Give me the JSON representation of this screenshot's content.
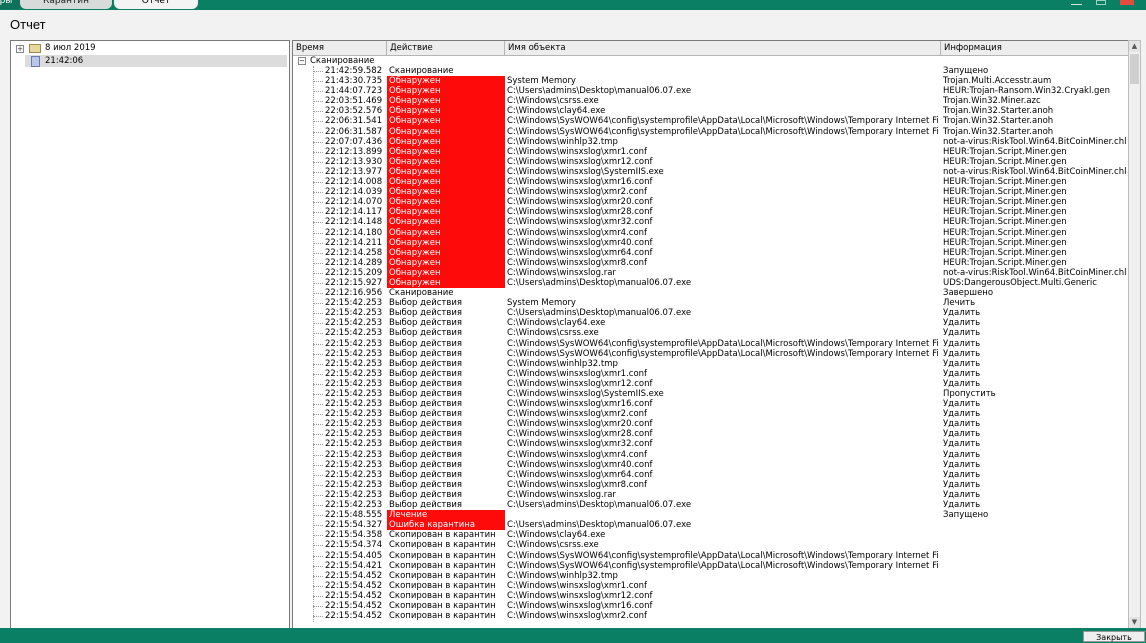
{
  "tabs": {
    "left": "ры",
    "quarantine": "Карантин",
    "report": "Отчет"
  },
  "title": "Отчет",
  "tree": {
    "date": "8 июл 2019",
    "time": "21:42:06"
  },
  "columns": {
    "time": "Время",
    "action": "Действие",
    "object": "Имя объекта",
    "info": "Информация"
  },
  "group_label": "Сканирование",
  "close_label": "Закрыть",
  "colors": {
    "detected": "#ff0a0a",
    "frame": "#0b7f63"
  },
  "rows": [
    {
      "time": "21:42:59.582",
      "action": "Сканирование",
      "object": "",
      "info": "Запущено",
      "red": false
    },
    {
      "time": "21:43:30.735",
      "action": "Обнаружен",
      "object": "System Memory",
      "info": "Trojan.Multi.Accesstr.aum",
      "red": true
    },
    {
      "time": "21:44:07.723",
      "action": "Обнаружен",
      "object": "C:\\Users\\admins\\Desktop\\manual06.07.exe",
      "info": "HEUR:Trojan-Ransom.Win32.Cryakl.gen",
      "red": true
    },
    {
      "time": "22:03:51.469",
      "action": "Обнаружен",
      "object": "C:\\Windows\\csrss.exe",
      "info": "Trojan.Win32.Miner.azc",
      "red": true
    },
    {
      "time": "22:03:52.576",
      "action": "Обнаружен",
      "object": "C:\\Windows\\clay64.exe",
      "info": "Trojan.Win32.Starter.anoh",
      "red": true
    },
    {
      "time": "22:06:31.541",
      "action": "Обнаружен",
      "object": "C:\\Windows\\SysWOW64\\config\\systemprofile\\AppData\\Local\\Microsoft\\Windows\\Temporary Internet Files\\...",
      "info": "Trojan.Win32.Starter.anoh",
      "red": true
    },
    {
      "time": "22:06:31.587",
      "action": "Обнаружен",
      "object": "C:\\Windows\\SysWOW64\\config\\systemprofile\\AppData\\Local\\Microsoft\\Windows\\Temporary Internet Files\\...",
      "info": "Trojan.Win32.Starter.anoh",
      "red": true
    },
    {
      "time": "22:07:07.436",
      "action": "Обнаружен",
      "object": "C:\\Windows\\winhlp32.tmp",
      "info": "not-a-virus:RiskTool.Win64.BitCoinMiner.chl",
      "red": true
    },
    {
      "time": "22:12:13.899",
      "action": "Обнаружен",
      "object": "C:\\Windows\\winsxslog\\xmr1.conf",
      "info": "HEUR:Trojan.Script.Miner.gen",
      "red": true
    },
    {
      "time": "22:12:13.930",
      "action": "Обнаружен",
      "object": "C:\\Windows\\winsxslog\\xmr12.conf",
      "info": "HEUR:Trojan.Script.Miner.gen",
      "red": true
    },
    {
      "time": "22:12:13.977",
      "action": "Обнаружен",
      "object": "C:\\Windows\\winsxslog\\SystemIIS.exe",
      "info": "not-a-virus:RiskTool.Win64.BitCoinMiner.chl",
      "red": true
    },
    {
      "time": "22:12:14.008",
      "action": "Обнаружен",
      "object": "C:\\Windows\\winsxslog\\xmr16.conf",
      "info": "HEUR:Trojan.Script.Miner.gen",
      "red": true
    },
    {
      "time": "22:12:14.039",
      "action": "Обнаружен",
      "object": "C:\\Windows\\winsxslog\\xmr2.conf",
      "info": "HEUR:Trojan.Script.Miner.gen",
      "red": true
    },
    {
      "time": "22:12:14.070",
      "action": "Обнаружен",
      "object": "C:\\Windows\\winsxslog\\xmr20.conf",
      "info": "HEUR:Trojan.Script.Miner.gen",
      "red": true
    },
    {
      "time": "22:12:14.117",
      "action": "Обнаружен",
      "object": "C:\\Windows\\winsxslog\\xmr28.conf",
      "info": "HEUR:Trojan.Script.Miner.gen",
      "red": true
    },
    {
      "time": "22:12:14.148",
      "action": "Обнаружен",
      "object": "C:\\Windows\\winsxslog\\xmr32.conf",
      "info": "HEUR:Trojan.Script.Miner.gen",
      "red": true
    },
    {
      "time": "22:12:14.180",
      "action": "Обнаружен",
      "object": "C:\\Windows\\winsxslog\\xmr4.conf",
      "info": "HEUR:Trojan.Script.Miner.gen",
      "red": true
    },
    {
      "time": "22:12:14.211",
      "action": "Обнаружен",
      "object": "C:\\Windows\\winsxslog\\xmr40.conf",
      "info": "HEUR:Trojan.Script.Miner.gen",
      "red": true
    },
    {
      "time": "22:12:14.258",
      "action": "Обнаружен",
      "object": "C:\\Windows\\winsxslog\\xmr64.conf",
      "info": "HEUR:Trojan.Script.Miner.gen",
      "red": true
    },
    {
      "time": "22:12:14.289",
      "action": "Обнаружен",
      "object": "C:\\Windows\\winsxslog\\xmr8.conf",
      "info": "HEUR:Trojan.Script.Miner.gen",
      "red": true
    },
    {
      "time": "22:12:15.209",
      "action": "Обнаружен",
      "object": "C:\\Windows\\winsxslog.rar",
      "info": "not-a-virus:RiskTool.Win64.BitCoinMiner.chl",
      "red": true
    },
    {
      "time": "22:12:15.927",
      "action": "Обнаружен",
      "object": "C:\\Users\\admins\\Desktop\\manual06.07.exe",
      "info": "UDS:DangerousObject.Multi.Generic",
      "red": true
    },
    {
      "time": "22:12:16.956",
      "action": "Сканирование",
      "object": "",
      "info": "Завершено",
      "red": false
    },
    {
      "time": "22:15:42.253",
      "action": "Выбор действия",
      "object": "System Memory",
      "info": "Лечить",
      "red": false
    },
    {
      "time": "22:15:42.253",
      "action": "Выбор действия",
      "object": "C:\\Users\\admins\\Desktop\\manual06.07.exe",
      "info": "Удалить",
      "red": false
    },
    {
      "time": "22:15:42.253",
      "action": "Выбор действия",
      "object": "C:\\Windows\\clay64.exe",
      "info": "Удалить",
      "red": false
    },
    {
      "time": "22:15:42.253",
      "action": "Выбор действия",
      "object": "C:\\Windows\\csrss.exe",
      "info": "Удалить",
      "red": false
    },
    {
      "time": "22:15:42.253",
      "action": "Выбор действия",
      "object": "C:\\Windows\\SysWOW64\\config\\systemprofile\\AppData\\Local\\Microsoft\\Windows\\Temporary Internet Files\\...",
      "info": "Удалить",
      "red": false
    },
    {
      "time": "22:15:42.253",
      "action": "Выбор действия",
      "object": "C:\\Windows\\SysWOW64\\config\\systemprofile\\AppData\\Local\\Microsoft\\Windows\\Temporary Internet Files\\...",
      "info": "Удалить",
      "red": false
    },
    {
      "time": "22:15:42.253",
      "action": "Выбор действия",
      "object": "C:\\Windows\\winhlp32.tmp",
      "info": "Удалить",
      "red": false
    },
    {
      "time": "22:15:42.253",
      "action": "Выбор действия",
      "object": "C:\\Windows\\winsxslog\\xmr1.conf",
      "info": "Удалить",
      "red": false
    },
    {
      "time": "22:15:42.253",
      "action": "Выбор действия",
      "object": "C:\\Windows\\winsxslog\\xmr12.conf",
      "info": "Удалить",
      "red": false
    },
    {
      "time": "22:15:42.253",
      "action": "Выбор действия",
      "object": "C:\\Windows\\winsxslog\\SystemIIS.exe",
      "info": "Пропустить",
      "red": false
    },
    {
      "time": "22:15:42.253",
      "action": "Выбор действия",
      "object": "C:\\Windows\\winsxslog\\xmr16.conf",
      "info": "Удалить",
      "red": false
    },
    {
      "time": "22:15:42.253",
      "action": "Выбор действия",
      "object": "C:\\Windows\\winsxslog\\xmr2.conf",
      "info": "Удалить",
      "red": false
    },
    {
      "time": "22:15:42.253",
      "action": "Выбор действия",
      "object": "C:\\Windows\\winsxslog\\xmr20.conf",
      "info": "Удалить",
      "red": false
    },
    {
      "time": "22:15:42.253",
      "action": "Выбор действия",
      "object": "C:\\Windows\\winsxslog\\xmr28.conf",
      "info": "Удалить",
      "red": false
    },
    {
      "time": "22:15:42.253",
      "action": "Выбор действия",
      "object": "C:\\Windows\\winsxslog\\xmr32.conf",
      "info": "Удалить",
      "red": false
    },
    {
      "time": "22:15:42.253",
      "action": "Выбор действия",
      "object": "C:\\Windows\\winsxslog\\xmr4.conf",
      "info": "Удалить",
      "red": false
    },
    {
      "time": "22:15:42.253",
      "action": "Выбор действия",
      "object": "C:\\Windows\\winsxslog\\xmr40.conf",
      "info": "Удалить",
      "red": false
    },
    {
      "time": "22:15:42.253",
      "action": "Выбор действия",
      "object": "C:\\Windows\\winsxslog\\xmr64.conf",
      "info": "Удалить",
      "red": false
    },
    {
      "time": "22:15:42.253",
      "action": "Выбор действия",
      "object": "C:\\Windows\\winsxslog\\xmr8.conf",
      "info": "Удалить",
      "red": false
    },
    {
      "time": "22:15:42.253",
      "action": "Выбор действия",
      "object": "C:\\Windows\\winsxslog.rar",
      "info": "Удалить",
      "red": false
    },
    {
      "time": "22:15:42.253",
      "action": "Выбор действия",
      "object": "C:\\Users\\admins\\Desktop\\manual06.07.exe",
      "info": "Удалить",
      "red": false
    },
    {
      "time": "22:15:48.555",
      "action": "Лечение",
      "object": "",
      "info": "Запущено",
      "red": true
    },
    {
      "time": "22:15:54.327",
      "action": "Ошибка карантина",
      "object": "C:\\Users\\admins\\Desktop\\manual06.07.exe",
      "info": "",
      "red": true
    },
    {
      "time": "22:15:54.358",
      "action": "Скопирован в карантин",
      "object": "C:\\Windows\\clay64.exe",
      "info": "",
      "red": false
    },
    {
      "time": "22:15:54.374",
      "action": "Скопирован в карантин",
      "object": "C:\\Windows\\csrss.exe",
      "info": "",
      "red": false
    },
    {
      "time": "22:15:54.405",
      "action": "Скопирован в карантин",
      "object": "C:\\Windows\\SysWOW64\\config\\systemprofile\\AppData\\Local\\Microsoft\\Windows\\Temporary Internet Files\\...",
      "info": "",
      "red": false
    },
    {
      "time": "22:15:54.421",
      "action": "Скопирован в карантин",
      "object": "C:\\Windows\\SysWOW64\\config\\systemprofile\\AppData\\Local\\Microsoft\\Windows\\Temporary Internet Files\\...",
      "info": "",
      "red": false
    },
    {
      "time": "22:15:54.452",
      "action": "Скопирован в карантин",
      "object": "C:\\Windows\\winhlp32.tmp",
      "info": "",
      "red": false
    },
    {
      "time": "22:15:54.452",
      "action": "Скопирован в карантин",
      "object": "C:\\Windows\\winsxslog\\xmr1.conf",
      "info": "",
      "red": false
    },
    {
      "time": "22:15:54.452",
      "action": "Скопирован в карантин",
      "object": "C:\\Windows\\winsxslog\\xmr12.conf",
      "info": "",
      "red": false
    },
    {
      "time": "22:15:54.452",
      "action": "Скопирован в карантин",
      "object": "C:\\Windows\\winsxslog\\xmr16.conf",
      "info": "",
      "red": false
    },
    {
      "time": "22:15:54.452",
      "action": "Скопирован в карантин",
      "object": "C:\\Windows\\winsxslog\\xmr2.conf",
      "info": "",
      "red": false
    }
  ]
}
